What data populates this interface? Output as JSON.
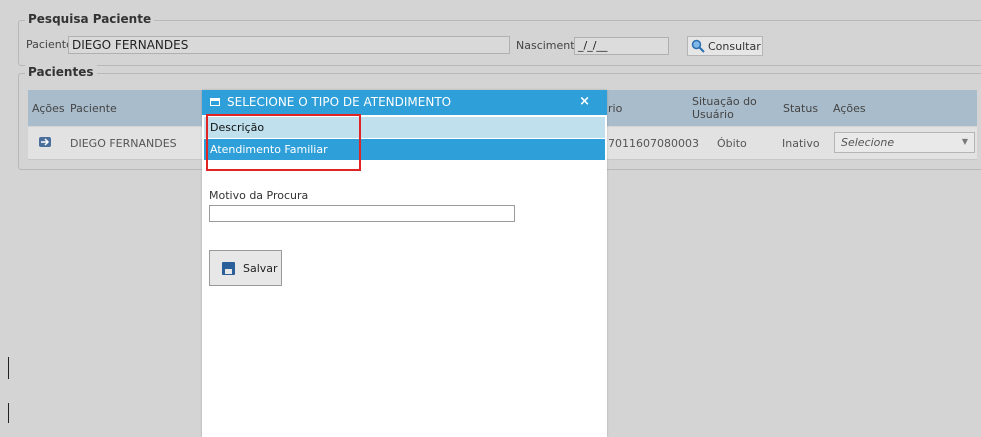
{
  "pesquisa": {
    "legend": "Pesquisa Paciente",
    "paciente_label": "Paciente:",
    "paciente_value": "DIEGO FERNANDES",
    "nascimento_label": "Nascimento:",
    "nascimento_value": "_/_/__",
    "consultar_label": "Consultar"
  },
  "pacientes": {
    "legend": "Pacientes",
    "columns": {
      "acoes1": "Ações",
      "paciente": "Paciente",
      "cartao_partial": "rio",
      "situacao_line1": "Situação do",
      "situacao_line2": "Usuário",
      "status": "Status",
      "acoes2": "Ações"
    },
    "row": {
      "paciente": "DIEGO FERNANDES",
      "cartao": "7011607080003",
      "situacao": "Óbito",
      "status": "Inativo",
      "select_value": "Selecione"
    }
  },
  "modal": {
    "title": "SELECIONE O TIPO DE ATENDIMENTO",
    "close": "×",
    "dropdown_header": "Descrição",
    "dropdown_option": "Atendimento Familiar",
    "motivo_label": "Motivo da Procura",
    "salvar_label": "Salvar"
  },
  "colors": {
    "accent": "#2e9fd8",
    "highlight_border": "#e02424",
    "table_header": "#a9bccb"
  }
}
